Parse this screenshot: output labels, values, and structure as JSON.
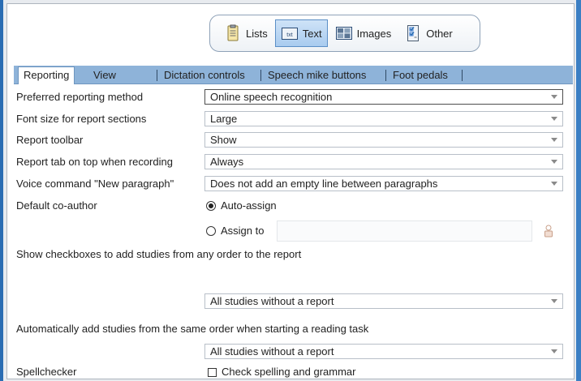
{
  "categories": [
    {
      "label": "Lists",
      "icon": "lists-icon",
      "active": false
    },
    {
      "label": "Text",
      "icon": "text-icon",
      "active": true
    },
    {
      "label": "Images",
      "icon": "images-icon",
      "active": false
    },
    {
      "label": "Other",
      "icon": "other-icon",
      "active": false
    }
  ],
  "tabs": [
    "Reporting",
    "View",
    "Dictation controls",
    "Speech mike buttons",
    "Foot pedals"
  ],
  "active_tab": "Reporting",
  "settings": {
    "reporting_method": {
      "label": "Preferred reporting method",
      "value": "Online speech recognition"
    },
    "font_size": {
      "label": "Font size for report sections",
      "value": "Large"
    },
    "report_toolbar": {
      "label": "Report toolbar",
      "value": "Show"
    },
    "report_tab_on_top": {
      "label": "Report tab on top when recording",
      "value": "Always"
    },
    "voice_new_paragraph": {
      "label": "Voice command \"New paragraph\"",
      "value": "Does not add an empty line between paragraphs"
    },
    "default_coauthor": {
      "label": "Default co-author",
      "auto_assign_label": "Auto-assign",
      "assign_to_label": "Assign to",
      "selected": "auto_assign",
      "assign_to_value": ""
    },
    "show_checkboxes": {
      "label": "Show checkboxes to add studies from any order to the report",
      "value": "All studies without a report"
    },
    "auto_add_studies": {
      "label": "Automatically add studies from the same order when starting a reading task",
      "value": "All studies without a report"
    },
    "spellchecker": {
      "label": "Spellchecker",
      "checkbox_label": "Check spelling and grammar",
      "checked": false
    }
  },
  "colors": {
    "accent": "#2a6db3",
    "tab_bar": "#8eb3d9",
    "active_category": "#a8cbef"
  }
}
